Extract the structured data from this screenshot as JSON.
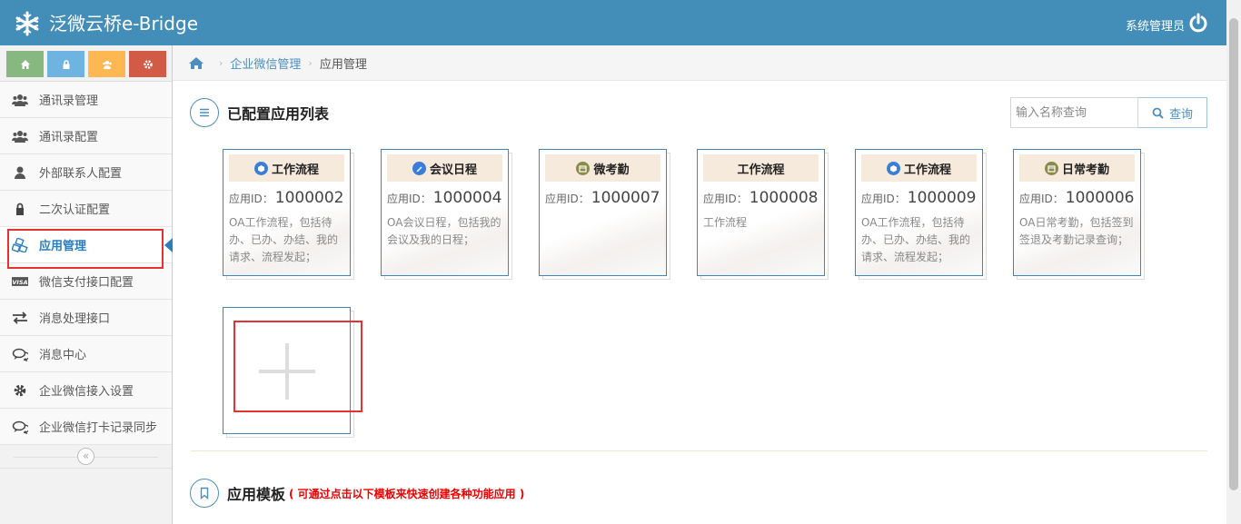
{
  "header": {
    "logo_text": "泛微云桥e-Bridge",
    "user_name": "系统管理员",
    "accent_color": "#438eb9"
  },
  "shortcuts": [
    {
      "icon": "home-icon",
      "color": "#87b87f"
    },
    {
      "icon": "lock-icon",
      "color": "#6fb3e0"
    },
    {
      "icon": "users-icon",
      "color": "#ffb752"
    },
    {
      "icon": "gear-icon",
      "color": "#d15b47"
    }
  ],
  "sidebar": {
    "items": [
      {
        "label": "通讯录管理",
        "icon": "users-icon"
      },
      {
        "label": "通讯录配置",
        "icon": "users-icon"
      },
      {
        "label": "外部联系人配置",
        "icon": "user-icon"
      },
      {
        "label": "二次认证配置",
        "icon": "lock-icon"
      },
      {
        "label": "应用管理",
        "icon": "cubes-icon",
        "active": true
      },
      {
        "label": "微信支付接口配置",
        "icon": "visa-icon"
      },
      {
        "label": "消息处理接口",
        "icon": "exchange-icon"
      },
      {
        "label": "消息中心",
        "icon": "comments-icon"
      },
      {
        "label": "企业微信接入设置",
        "icon": "gear-icon"
      },
      {
        "label": "企业微信打卡记录同步",
        "icon": "comments-icon"
      }
    ],
    "collapse_glyph": "«"
  },
  "breadcrumb": {
    "items": [
      "企业微信管理",
      "应用管理"
    ],
    "separator": "›"
  },
  "configured": {
    "title": "已配置应用列表",
    "search": {
      "placeholder": "输入名称查询",
      "button_label": "查询"
    },
    "id_label": "应用ID：",
    "apps": [
      {
        "name": "工作流程",
        "id": "1000002",
        "desc": "OA工作流程，包括待办、已办、办结、我的请求、流程发起；",
        "icon": "workflow-icon",
        "icon_color": "#3b7ed9"
      },
      {
        "name": "会议日程",
        "id": "1000004",
        "desc": "OA会议日程，包括我的会议及我的日程；",
        "icon": "meeting-icon",
        "icon_color": "#3b7ed9"
      },
      {
        "name": "微考勤",
        "id": "1000007",
        "desc": "",
        "icon": "calendar-icon",
        "icon_color": "#8a8a4b"
      },
      {
        "name": "工作流程",
        "id": "1000008",
        "desc": "工作流程",
        "icon": "",
        "icon_color": ""
      },
      {
        "name": "工作流程",
        "id": "1000009",
        "desc": "OA工作流程，包括待办、已办、办结、我的请求、流程发起；",
        "icon": "workflow-icon",
        "icon_color": "#3b7ed9"
      },
      {
        "name": "日常考勤",
        "id": "1000006",
        "desc": "OA日常考勤，包括签到签退及考勤记录查询；",
        "icon": "calendar-icon",
        "icon_color": "#8a8a4b"
      }
    ]
  },
  "templates": {
    "title": "应用模板",
    "hint": "( 可通过点击以下模板来快速创建各种功能应用 )"
  }
}
